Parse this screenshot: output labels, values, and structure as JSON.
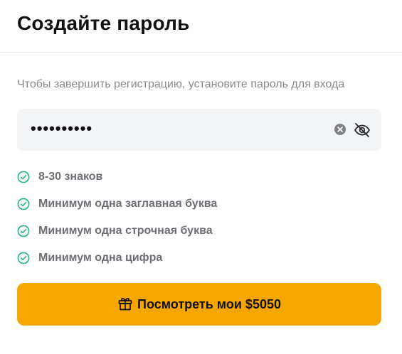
{
  "header": {
    "title": "Создайте пароль"
  },
  "form": {
    "subtitle": "Чтобы завершить регистрацию, установите пароль для входа",
    "password_masked": "••••••••••",
    "clear_icon": "clear-circle-icon",
    "visibility_icon": "eye-off-icon"
  },
  "requirements": [
    {
      "label": "8-30 знаков",
      "met": true
    },
    {
      "label": "Минимум одна заглавная буква",
      "met": true
    },
    {
      "label": "Минимум одна строчная буква",
      "met": true
    },
    {
      "label": "Минимум одна цифра",
      "met": true
    }
  ],
  "cta": {
    "label": "Посмотреть мои $5050",
    "icon": "gift-icon"
  },
  "colors": {
    "accent": "#f6a600",
    "check": "#23b67a",
    "field_bg": "#f3f4f6",
    "muted_text": "#898a8f"
  }
}
